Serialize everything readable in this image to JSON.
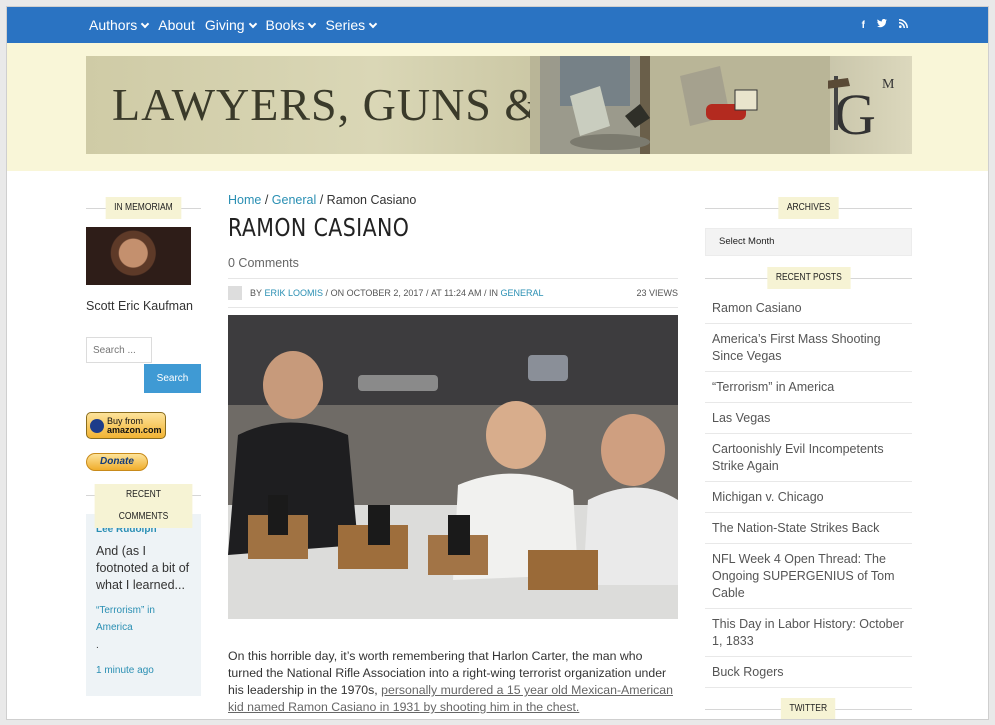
{
  "nav": {
    "items": [
      {
        "label": "Authors",
        "dropdown": true
      },
      {
        "label": "About",
        "dropdown": false
      },
      {
        "label": "Giving",
        "dropdown": true
      },
      {
        "label": "Books",
        "dropdown": true
      },
      {
        "label": "Series",
        "dropdown": true
      }
    ],
    "social": [
      "f",
      "t",
      "rss"
    ],
    "color": "#2a73c2"
  },
  "header": {
    "site_title": "LAWYERS, GUNS & MONEY",
    "logo_text": "LGM",
    "background": "#f9f6d8"
  },
  "left_sidebar": {
    "memoriam_title": "IN MEMORIAM",
    "memoriam_name": "Scott Eric Kaufman",
    "search_placeholder": "Search ...",
    "search_button": "Search",
    "amazon_line1": "Buy from",
    "amazon_line2": "amazon.com",
    "donate_label": "Donate",
    "recent_comments_title": "RECENT COMMENTS",
    "comment": {
      "author": "Lee Rudolph",
      "excerpt": "And (as I footnoted a bit of what I learned...",
      "post_link": "“Terrorism” in America",
      "dot": ".",
      "time": "1 minute ago"
    }
  },
  "main": {
    "breadcrumb": {
      "home": "Home",
      "category": "General",
      "current": "Ramon Casiano"
    },
    "title": "RAMON CASIANO",
    "comments": "0 Comments",
    "meta": {
      "by": "BY",
      "author": "ERIK LOOMIS",
      "date": "ON OCTOBER 2, 2017",
      "time": "AT 11:24 AM",
      "in": "IN",
      "category": "GENERAL",
      "views": "23 VIEWS"
    },
    "body_text": "On this horrible day, it’s worth remembering that Harlon Carter, the man who turned the National Rifle Association into a right-wing terrorist organization under his leadership in the 1970s,",
    "body_link": "personally murdered a 15 year old Mexican-American kid named Ramon Casiano in 1931 by shooting him in the chest."
  },
  "right_sidebar": {
    "archives_title": "ARCHIVES",
    "archives_select": "Select Month",
    "recent_posts_title": "RECENT POSTS",
    "recent_posts": [
      "Ramon Casiano",
      "America’s First Mass Shooting Since Vegas",
      "“Terrorism” in America",
      "Las Vegas",
      "Cartoonishly Evil Incompetents Strike Again",
      "Michigan v. Chicago",
      "The Nation-State Strikes Back",
      "NFL Week 4 Open Thread: The Ongoing SUPERGENIUS of Tom Cable",
      "This Day in Labor History: October 1, 1833",
      "Buck Rogers"
    ],
    "twitter_title": "TWITTER"
  }
}
